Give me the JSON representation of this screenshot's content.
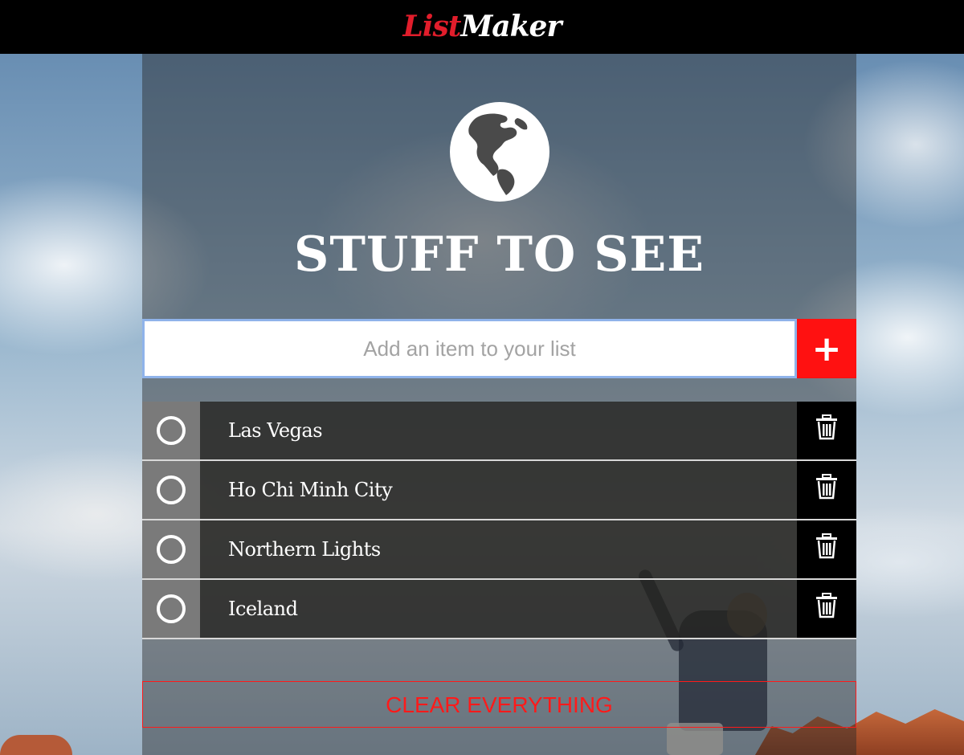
{
  "app": {
    "logo_part1": "List",
    "logo_part2": "Maker"
  },
  "list": {
    "title": "STUFF TO SEE",
    "icon": "globe-icon",
    "add_placeholder": "Add an item to your list",
    "add_button_label": "+",
    "items": [
      {
        "label": "Las Vegas",
        "checked": false
      },
      {
        "label": "Ho Chi Minh City",
        "checked": false
      },
      {
        "label": "Northern Lights",
        "checked": false
      },
      {
        "label": "Iceland",
        "checked": false
      }
    ],
    "clear_label": "CLEAR EVERYTHING"
  },
  "colors": {
    "header_bg": "#000000",
    "logo_accent": "#e11d2b",
    "add_button": "#ff1111",
    "clear_text": "#ff1a1a",
    "input_focus_border": "#8fb3ea"
  }
}
